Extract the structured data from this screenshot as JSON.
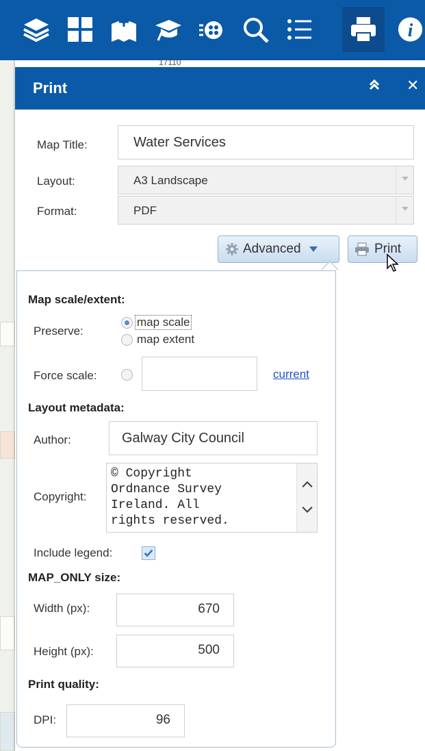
{
  "toolbar": {
    "icons": [
      "layers-icon",
      "basemap-gallery-icon",
      "add-data-icon",
      "education-icon",
      "analysis-icon",
      "search-icon",
      "legend-list-icon",
      "print-icon",
      "info-icon"
    ],
    "active": "print-icon",
    "color": "#0b5aa8",
    "map_label": "17110"
  },
  "panel": {
    "title": "Print",
    "collapse_icon": "chevron-double-up-icon",
    "close_label": "✕"
  },
  "form": {
    "map_title_label": "Map Title:",
    "map_title_value": "Water Services",
    "layout_label": "Layout:",
    "layout_value": "A3 Landscape",
    "format_label": "Format:",
    "format_value": "PDF"
  },
  "buttons": {
    "advanced_label": "Advanced",
    "print_label": "Print"
  },
  "advanced": {
    "map_scale_section": "Map scale/extent:",
    "preserve_label": "Preserve:",
    "preserve_options": [
      "map scale",
      "map extent"
    ],
    "preserve_selected": "map scale",
    "force_scale_label": "Force scale:",
    "force_scale_value": "",
    "current_link": "current",
    "layout_metadata_section": "Layout metadata:",
    "author_label": "Author:",
    "author_value": "Galway City Council",
    "copyright_label": "Copyright:",
    "copyright_lines": [
      "© Copyright",
      "Ordnance Survey",
      "Ireland. All",
      "rights reserved."
    ],
    "include_legend_label": "Include legend:",
    "include_legend_checked": true,
    "map_only_section": "MAP_ONLY size:",
    "width_label": "Width (px):",
    "width_value": "670",
    "height_label": "Height (px):",
    "height_value": "500",
    "print_quality_section": "Print quality:",
    "dpi_label": "DPI:",
    "dpi_value": "96"
  }
}
